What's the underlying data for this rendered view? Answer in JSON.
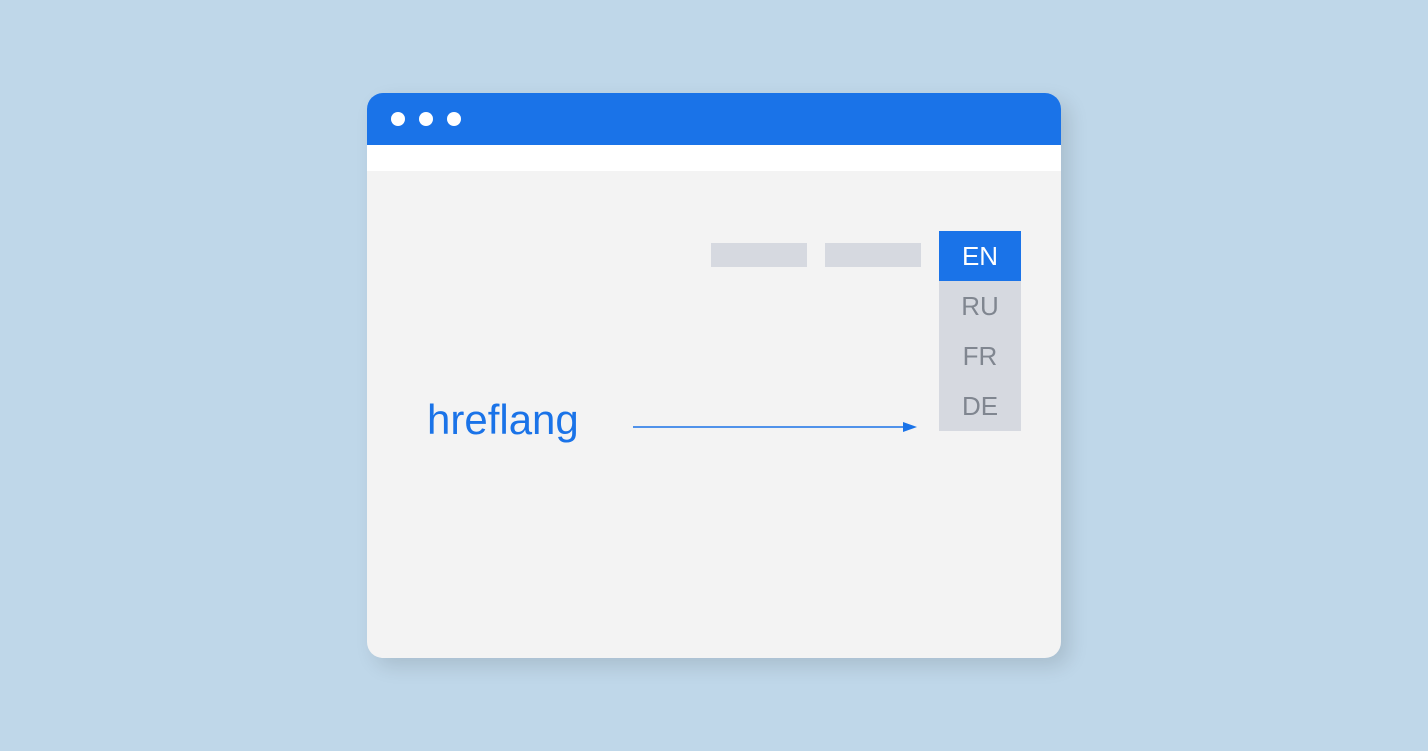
{
  "label": "hreflang",
  "languages": {
    "selected": "EN",
    "options": [
      "RU",
      "FR",
      "DE"
    ]
  },
  "colors": {
    "accent": "#1a73e8",
    "background": "#bfd7e9",
    "window": "#f3f3f3",
    "placeholder": "#d6d9e0",
    "muted_text": "#808690"
  }
}
